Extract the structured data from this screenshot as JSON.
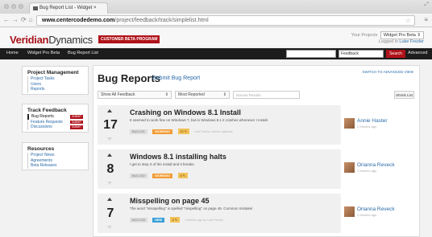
{
  "browser": {
    "tab_title": "Bug Report List - Widget ×",
    "url_host": "www.centercodedemo.com",
    "url_path": "/project/feedback/track/simplelist.html"
  },
  "header": {
    "logo_part1": "Veridian",
    "logo_part2": "Dynamics",
    "beta_badge": "CUSTOMER BETA PROGRAM",
    "your_projects_label": "Your Projects",
    "project_selected": "Widget Pro Beta ⇕",
    "logged_in_prefix": "Logged in",
    "logged_in_user": "Luke Frezler"
  },
  "topnav": {
    "items": [
      "Home",
      "Widget Pro Beta",
      "Bug Report List"
    ],
    "filter_selected": "Feedback",
    "search_button": "Search",
    "advanced": "Advanced"
  },
  "sidebar": {
    "sections": [
      {
        "title": "Project Management",
        "links": [
          {
            "label": "Project Tasks"
          },
          {
            "label": "Users"
          },
          {
            "label": "Reports"
          }
        ]
      },
      {
        "title": "Track Feedback",
        "links": [
          {
            "label": "Bug Reports",
            "badge": "SUBMIT",
            "active": true
          },
          {
            "label": "Feature Requests",
            "badge": "SUBMIT"
          },
          {
            "label": "Discussions",
            "badge": "SUBMIT"
          }
        ]
      },
      {
        "title": "Resources",
        "links": [
          {
            "label": "Project News"
          },
          {
            "label": "Agreements"
          },
          {
            "label": "Beta Releases"
          }
        ]
      }
    ]
  },
  "main": {
    "title": "Bug Reports",
    "submit_link": "Submit Bug Report",
    "switch_view": "SWITCH TO ADVANCED VIEW",
    "filter_feedback": "Show All Feedback",
    "sort": "Most Reported",
    "narrow_placeholder": "Narrow Results",
    "shrink_button": "Shrink List"
  },
  "colors": {
    "accent": "#b0121a",
    "working": "#f39c34",
    "new": "#3aa0d8"
  },
  "bugs": [
    {
      "count": "17",
      "title": "Crashing on Windows 8.1 Install",
      "desc": "It seemed to work fine on Windows 7, but in Windows 8.1 it crashes whenever I install.",
      "id": "BUG-001",
      "status": "WORKING",
      "status_color": "#f39c34",
      "comments": "22 ✎",
      "meta": "Last Post by James Lightman",
      "user": "Annie Haster",
      "when": "2 Months ago"
    },
    {
      "count": "8",
      "title": "Windows 8.1 installing halts",
      "desc": "I get to step 3 of the install and it breaks.",
      "id": "BUG-002",
      "status": "WORKING",
      "status_color": "#f39c34",
      "comments": "8 ✎",
      "meta": "",
      "user": "Orianna Reveck",
      "when": "2 Months ago"
    },
    {
      "count": "7",
      "title": "Misspelling on page 45",
      "desc": "The word \"misspelling\" is spelled \"mispelling\" on page 45. Common mistake!",
      "id": "BUG-005",
      "status": "NEW",
      "status_color": "#3aa0d8",
      "comments": "6 ✎",
      "meta": "2 Months ago by Luke Frezler",
      "user": "Orianna Reveck",
      "when": "2 Months ago"
    }
  ]
}
